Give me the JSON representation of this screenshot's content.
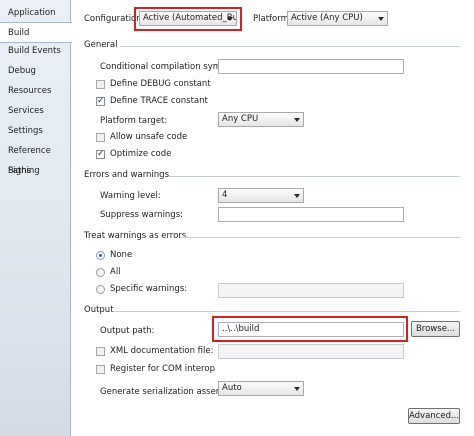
{
  "sidebar": {
    "tabs": [
      {
        "label": "Application"
      },
      {
        "label": "Build",
        "selected": true
      },
      {
        "label": "Build Events"
      },
      {
        "label": "Debug"
      },
      {
        "label": "Resources"
      },
      {
        "label": "Services"
      },
      {
        "label": "Settings"
      },
      {
        "label": "Reference Paths"
      },
      {
        "label": "Signing"
      }
    ]
  },
  "top": {
    "configuration_label": "Configuration:",
    "configuration_value": "Active (Automated_Build)",
    "platform_label": "Platform:",
    "platform_value": "Active (Any CPU)"
  },
  "general": {
    "header": "General",
    "conditional_label": "Conditional compilation symbols:",
    "conditional_value": "",
    "define_debug_label": "Define DEBUG constant",
    "define_debug_checked": false,
    "define_trace_label": "Define TRACE constant",
    "define_trace_checked": true,
    "platform_target_label": "Platform target:",
    "platform_target_value": "Any CPU",
    "allow_unsafe_label": "Allow unsafe code",
    "allow_unsafe_checked": false,
    "optimize_label": "Optimize code",
    "optimize_checked": true
  },
  "errors": {
    "header": "Errors and warnings",
    "warning_level_label": "Warning level:",
    "warning_level_value": "4",
    "suppress_label": "Suppress warnings:",
    "suppress_value": ""
  },
  "treat": {
    "header": "Treat warnings as errors",
    "none_label": "None",
    "all_label": "All",
    "specific_label": "Specific warnings:",
    "selected": "None",
    "specific_value": ""
  },
  "output": {
    "header": "Output",
    "output_path_label": "Output path:",
    "output_path_value": "..\\..\\build",
    "browse_label": "Browse...",
    "xml_doc_label": "XML documentation file:",
    "xml_doc_checked": false,
    "xml_doc_value": "",
    "register_com_label": "Register for COM interop",
    "register_com_checked": false,
    "serialization_label": "Generate serialization assembly:",
    "serialization_value": "Auto",
    "advanced_label": "Advanced..."
  },
  "colors": {
    "highlight": "#d42020",
    "sidebar_bg": "#e2e9f1",
    "radio_dot": "#2d5fa8"
  }
}
